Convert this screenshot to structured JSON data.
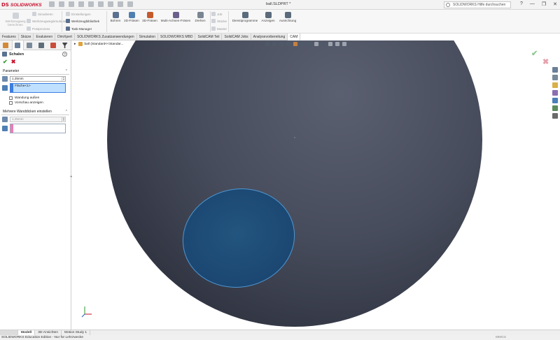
{
  "app": {
    "brand": "SOLIDWORKS",
    "document_title": "ball.SLDPRT *",
    "help_search_placeholder": "SOLIDWORKS Hilfe durchsuchen",
    "window_buttons": [
      "?",
      "—",
      "❐",
      "✕"
    ]
  },
  "ribbon": {
    "wz_bearbeiten": "Werkzeugweg berechnen",
    "simulieren": "Simulieren",
    "wegsimulation": "Werkzeugwegsimulation",
    "postprozess": "Postprozess",
    "einstellungen": "Einstellungen",
    "werkzeugbibliothek": "Werkzeugbibliothek",
    "task_manager": "Task-Manager",
    "bohren": "Bohren",
    "fraesen_2d": "2D-Fräsen",
    "fraesen_3d": "3D-Fräsen",
    "multi_achsen": "Multi-Achsen-Fräsen",
    "drehen": "Drehen",
    "job": "Job",
    "stueck": "Stücke",
    "master": "Master",
    "dienstprogramme": "Dienstprogramme",
    "anzeigen": "Anzeigen",
    "ausrichtung": "Ausrichtung"
  },
  "tabs": [
    "Features",
    "Skizze",
    "Evaluieren",
    "DimXpert",
    "SOLIDWORKS Zusatzanwendungen",
    "Simulation",
    "SOLIDWORKS MBD",
    "SolidCAM Teil",
    "SolidCAM Jobs",
    "Analysevorbereitung",
    "CAM"
  ],
  "active_tab": "CAM",
  "property_manager": {
    "title": "Schalen",
    "help": "?",
    "parameter_label": "Parameter",
    "thickness": "1.25mm",
    "faces_selected": "Fläche<1>",
    "shell_outward": "Wandung außen",
    "show_preview": "Vorschau anzeigen",
    "multi_thickness_label": "Mehrere Wanddicken einstellen",
    "multi_thickness": "1.25mm"
  },
  "viewport": {
    "tree_label": "ball  (Standard<<Standar..."
  },
  "bottom_tabs": [
    "Modell",
    "3D-Ansichten",
    "Motion Study 1"
  ],
  "active_bottom_tab": "Modell",
  "status": {
    "edition": "SOLIDWORKS Education Edition - Nur für Lehrzwecke",
    "units": "MMGS"
  },
  "colors": {
    "sphere_dark": "#3c4150",
    "face_selected": "#1f4f7d",
    "face_edge": "#4d97d3",
    "brand_red": "#c8102e"
  }
}
